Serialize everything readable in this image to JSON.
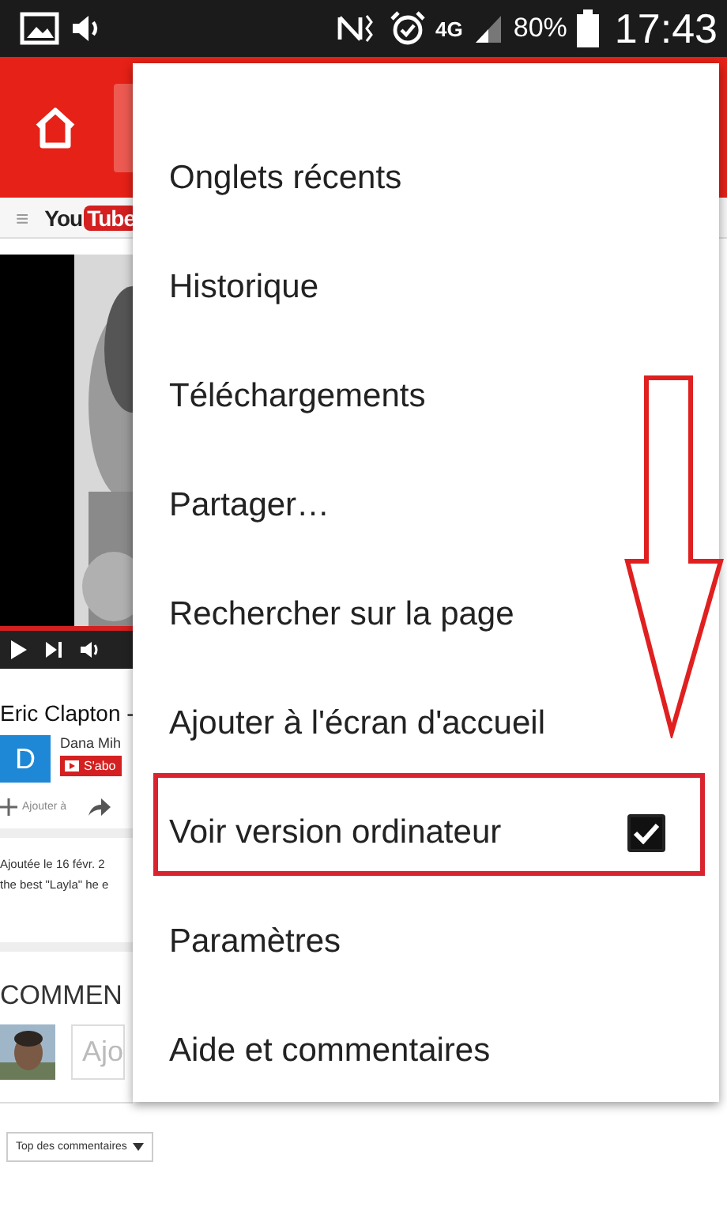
{
  "status_bar": {
    "network": "4G",
    "battery": "80%",
    "time": "17:43"
  },
  "youtube_bar": {
    "menu_glyph": "≡",
    "logo_left": "You",
    "logo_right": "Tube"
  },
  "video_page": {
    "title": "Eric Clapton -",
    "channel": "Dana Mih",
    "avatar_letter": "D",
    "subscribe": "S'abo",
    "add_to": "Ajouter à",
    "description_lines": [
      "Ajoutée le 16 févr. 2",
      "the best \"Layla\" he e"
    ],
    "comments_heading": "COMMEN",
    "comment_placeholder": "Ajo",
    "sort": "Top des commentaires"
  },
  "menu": {
    "items": [
      {
        "label": "Onglets récents",
        "kind": "plain",
        "highlighted": false
      },
      {
        "label": "Historique",
        "kind": "plain",
        "highlighted": false
      },
      {
        "label": "Téléchargements",
        "kind": "plain",
        "highlighted": false
      },
      {
        "label": "Partager…",
        "kind": "plain",
        "highlighted": false
      },
      {
        "label": "Rechercher sur la page",
        "kind": "plain",
        "highlighted": false
      },
      {
        "label": "Ajouter à l'écran d'accueil",
        "kind": "plain",
        "highlighted": false
      },
      {
        "label": "Voir version ordinateur",
        "kind": "checkbox",
        "checked": true,
        "highlighted": true
      },
      {
        "label": "Paramètres",
        "kind": "plain",
        "highlighted": false
      },
      {
        "label": "Aide et commentaires",
        "kind": "plain",
        "highlighted": false
      }
    ]
  }
}
